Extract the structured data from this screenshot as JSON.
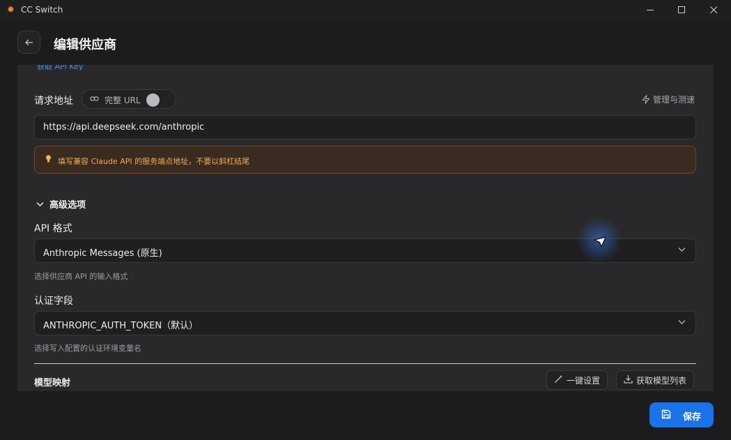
{
  "window": {
    "title": "CC Switch",
    "logo_icon": "sun-burst-icon"
  },
  "header": {
    "back_icon": "arrow-left-icon",
    "title": "编辑供应商"
  },
  "form": {
    "api_key_link": "获取 API Key",
    "endpoint": {
      "label": "请求地址",
      "full_url_toggle_label": "完整 URL",
      "full_url_toggle_on": false,
      "manage_label": "管理与测速",
      "value": "https://api.deepseek.com/anthropic",
      "warning": "填写兼容 Claude API 的服务端点地址，不要以斜杠结尾"
    },
    "advanced": {
      "title": "高级选项",
      "api_format": {
        "label": "API 格式",
        "selected": "Anthropic Messages (原生)",
        "hint": "选择供应商 API 的输入格式"
      },
      "auth_field": {
        "label": "认证字段",
        "selected": "ANTHROPIC_AUTH_TOKEN（默认）",
        "hint": "选择写入配置的认证环境变量名"
      }
    },
    "model_mapping": {
      "label": "模型映射",
      "one_click_label": "一键设置",
      "fetch_models_label": "获取模型列表"
    }
  },
  "footer": {
    "save_label": "保存"
  },
  "colors": {
    "accent": "#1a73e8",
    "warning_text": "#f0a95a",
    "link": "#4a90e2"
  }
}
